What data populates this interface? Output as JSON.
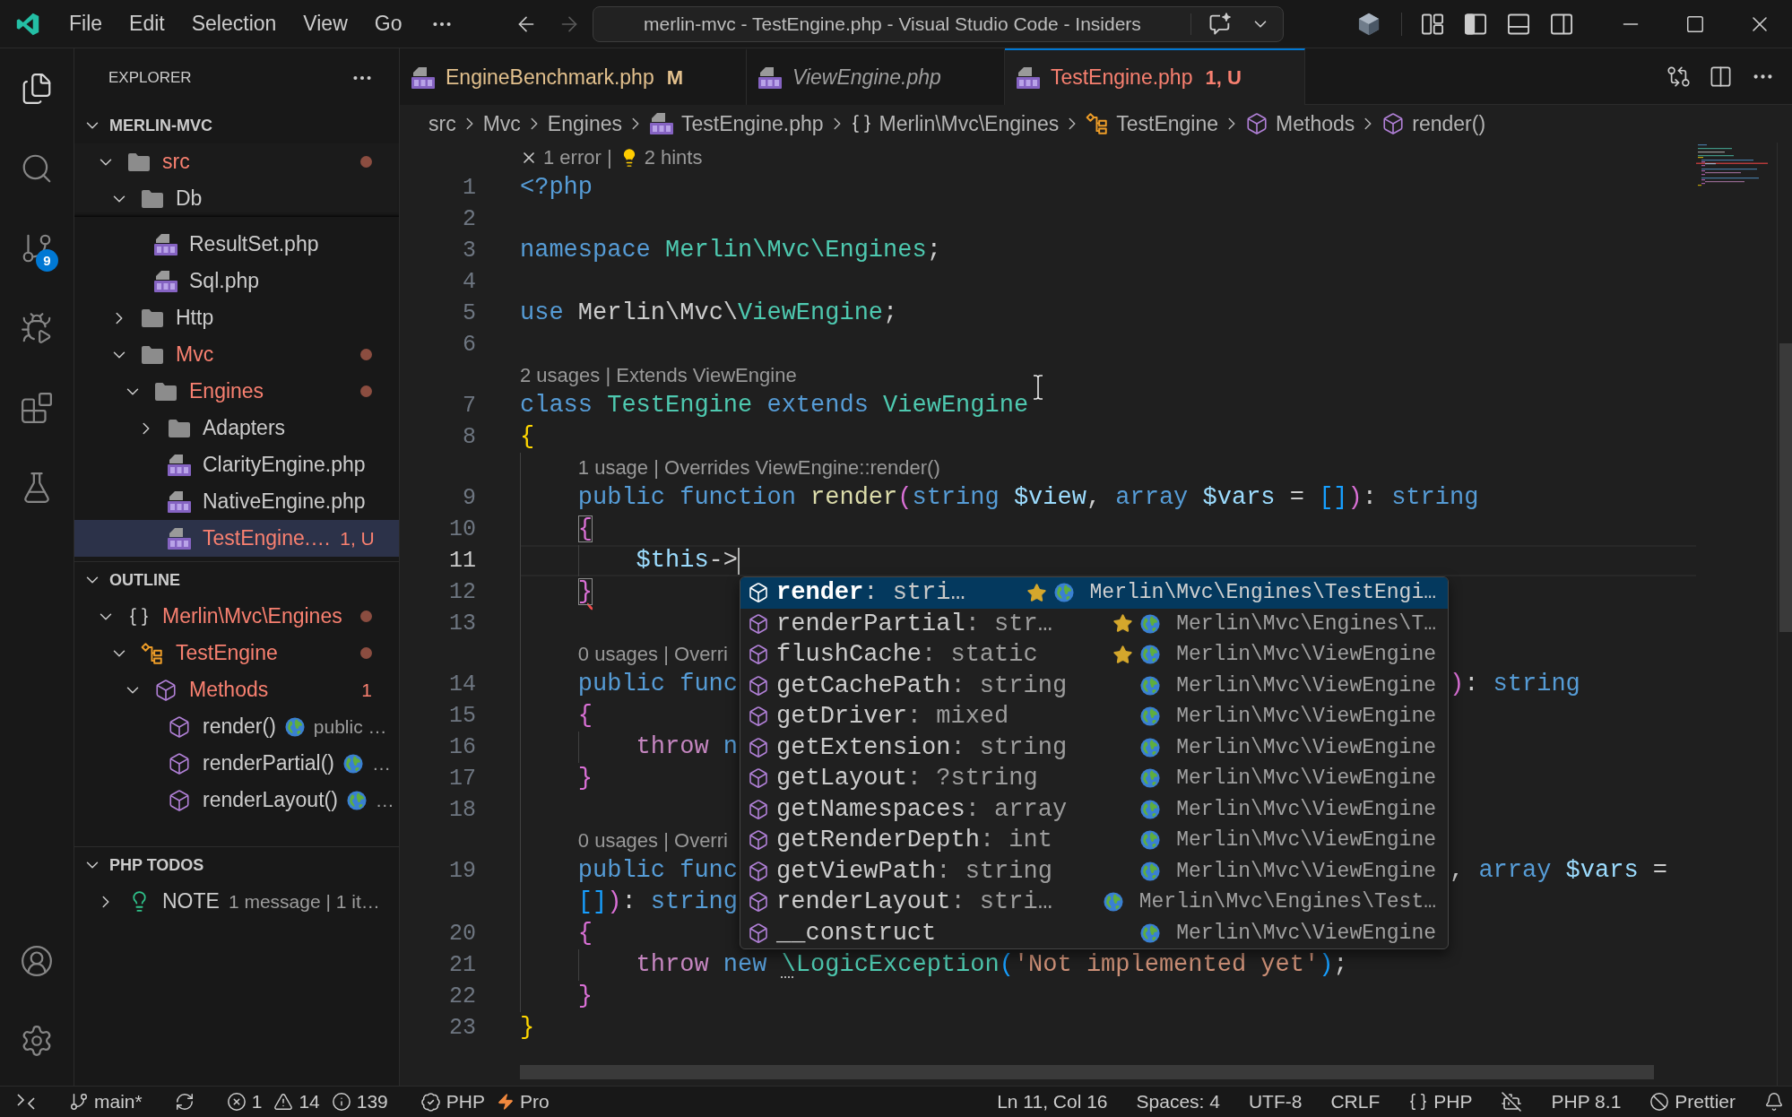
{
  "title_bar": {
    "menu": [
      "File",
      "Edit",
      "Selection",
      "View",
      "Go"
    ],
    "navigation": [
      {
        "kind": "back",
        "disabled": false
      },
      {
        "kind": "forward",
        "disabled": true
      }
    ],
    "command_center": "merlin-mvc - TestEngine.php - Visual Studio Code - Insiders"
  },
  "activity_bar": {
    "items": [
      {
        "kind": "explorer",
        "selected": true
      },
      {
        "kind": "search",
        "selected": false
      },
      {
        "kind": "source-control",
        "selected": false,
        "badge": "9"
      },
      {
        "kind": "run-debug",
        "selected": false
      },
      {
        "kind": "extensions",
        "selected": false
      },
      {
        "kind": "testing",
        "selected": false
      }
    ],
    "bottom": [
      {
        "kind": "accounts"
      },
      {
        "kind": "manage"
      }
    ]
  },
  "sidebar": {
    "title": "EXPLORER",
    "sections": [
      {
        "kind": "files",
        "title": "MERLIN-MVC",
        "expanded": true,
        "items": [
          {
            "kind": "folder",
            "label": "src",
            "expanded": true,
            "error": true,
            "dot": true,
            "sticky": true,
            "selected": false,
            "children": [
              {
                "kind": "folder",
                "label": "Db",
                "expanded": true,
                "error": false,
                "dot": false,
                "sticky": true,
                "selected": false,
                "children": [
                  {
                    "kind": "php",
                    "label": "ResultSet.php",
                    "error": false,
                    "dot": false,
                    "sticky": false,
                    "selected": false
                  },
                  {
                    "kind": "php",
                    "label": "Sql.php",
                    "error": false,
                    "dot": false,
                    "sticky": false,
                    "selected": false
                  }
                ]
              },
              {
                "kind": "folder",
                "label": "Http",
                "expanded": false,
                "error": false,
                "dot": false,
                "sticky": false,
                "selected": false
              },
              {
                "kind": "folder",
                "label": "Mvc",
                "expanded": true,
                "error": true,
                "dot": true,
                "sticky": false,
                "selected": false,
                "children": [
                  {
                    "kind": "folder",
                    "label": "Engines",
                    "expanded": true,
                    "error": true,
                    "dot": true,
                    "sticky": false,
                    "selected": false,
                    "children": [
                      {
                        "kind": "folder",
                        "label": "Adapters",
                        "expanded": false,
                        "error": false,
                        "dot": false,
                        "sticky": false,
                        "selected": false
                      },
                      {
                        "kind": "php",
                        "label": "ClarityEngine.php",
                        "error": false,
                        "dot": false,
                        "sticky": false,
                        "selected": false
                      },
                      {
                        "kind": "php",
                        "label": "NativeEngine.php",
                        "error": false,
                        "dot": false,
                        "sticky": false,
                        "selected": false
                      },
                      {
                        "kind": "php",
                        "label": "TestEngine.…",
                        "badge": "1, U",
                        "error": true,
                        "dot": false,
                        "sticky": false,
                        "selected": true
                      }
                    ]
                  }
                ]
              }
            ]
          }
        ]
      },
      {
        "kind": "outline",
        "title": "OUTLINE",
        "expanded": true,
        "items": [
          {
            "kind": "namespace",
            "label": "Merlin\\Mvc\\Engines",
            "expanded": true,
            "error": true,
            "dot": true,
            "selected": false,
            "children": [
              {
                "kind": "class",
                "label": "TestEngine",
                "expanded": true,
                "error": true,
                "dot": true,
                "selected": false,
                "children": [
                  {
                    "kind": "method",
                    "label": "Methods",
                    "expanded": true,
                    "badge": "1",
                    "error": true,
                    "dot": false,
                    "selected": false,
                    "children": [
                      {
                        "kind": "method",
                        "label": "render()",
                        "description": "public …",
                        "error": false,
                        "dot": false,
                        "selected": false
                      },
                      {
                        "kind": "method",
                        "label": "renderPartial()",
                        "description": "…",
                        "error": false,
                        "dot": false,
                        "selected": false
                      },
                      {
                        "kind": "method",
                        "label": "renderLayout()",
                        "description": "…",
                        "error": false,
                        "dot": false,
                        "selected": false
                      }
                    ]
                  }
                ]
              }
            ]
          }
        ]
      },
      {
        "kind": "todos",
        "title": "PHP TODOS",
        "expanded": true,
        "items": [
          {
            "kind": "note",
            "label": "NOTE",
            "expanded": false,
            "description": "1 message | 1 it…",
            "error": false,
            "dot": false,
            "selected": false
          }
        ]
      }
    ]
  },
  "editor": {
    "tabs": [
      {
        "label": "EngineBenchmark.php",
        "badge": "M",
        "modified": true,
        "error": false,
        "preview": false,
        "selected": false
      },
      {
        "label": "ViewEngine.php",
        "modified": false,
        "error": false,
        "preview": true,
        "selected": false
      },
      {
        "label": "TestEngine.php",
        "badge": "1, U",
        "modified": false,
        "error": true,
        "preview": false,
        "selected": true
      }
    ],
    "breadcrumbs": [
      {
        "kind": "folder",
        "label": "src"
      },
      {
        "kind": "folder",
        "label": "Mvc"
      },
      {
        "kind": "folder",
        "label": "Engines"
      },
      {
        "kind": "php",
        "label": "TestEngine.php"
      },
      {
        "kind": "namespace",
        "label": "Merlin\\Mvc\\Engines"
      },
      {
        "kind": "class",
        "label": "TestEngine"
      },
      {
        "kind": "method",
        "label": "Methods"
      },
      {
        "kind": "method",
        "label": "render()"
      }
    ],
    "rows": [
      {
        "kind": "problems",
        "items": [
          {
            "kind": "error",
            "text": "1 error |"
          },
          {
            "kind": "hint",
            "text": "2 hints"
          }
        ]
      },
      {
        "kind": "code",
        "number": "1",
        "current": false,
        "tokens": [
          {
            "text": "<?php",
            "kind": "keyword"
          }
        ]
      },
      {
        "kind": "code",
        "number": "2",
        "current": false
      },
      {
        "kind": "code",
        "number": "3",
        "current": false,
        "tokens": [
          {
            "text": "namespace ",
            "kind": "keyword"
          },
          {
            "text": "Merlin\\Mvc\\Engines",
            "kind": "type"
          },
          {
            "text": ";",
            "kind": "plain"
          }
        ]
      },
      {
        "kind": "code",
        "number": "4",
        "current": false
      },
      {
        "kind": "code",
        "number": "5",
        "current": false,
        "tokens": [
          {
            "text": "use ",
            "kind": "keyword"
          },
          {
            "text": "Merlin\\Mvc\\",
            "kind": "plain"
          },
          {
            "text": "ViewEngine",
            "kind": "type"
          },
          {
            "text": ";",
            "kind": "plain"
          }
        ]
      },
      {
        "kind": "code",
        "number": "6",
        "current": false
      },
      {
        "kind": "lens",
        "text": "2 usages | Extends ViewEngine"
      },
      {
        "kind": "code",
        "number": "7",
        "current": false,
        "tokens": [
          {
            "text": "class ",
            "kind": "keyword"
          },
          {
            "text": "TestEngine",
            "kind": "type"
          },
          {
            "text": " extends ",
            "kind": "keyword"
          },
          {
            "text": "ViewEngine",
            "kind": "type"
          }
        ]
      },
      {
        "kind": "code",
        "number": "8",
        "current": false,
        "tokens": [
          {
            "text": "{",
            "kind": "bracket1"
          }
        ],
        "children": [
          {
            "kind": "lens",
            "text": "1 usage | Overrides ViewEngine::render()"
          },
          {
            "kind": "code",
            "number": "9",
            "current": false,
            "tokens": [
              {
                "text": "public function ",
                "kind": "keyword"
              },
              {
                "text": "render",
                "kind": "function"
              },
              {
                "text": "(",
                "kind": "bracket2"
              },
              {
                "text": "string ",
                "kind": "keyword"
              },
              {
                "text": "$view",
                "kind": "variable"
              },
              {
                "text": ", ",
                "kind": "plain"
              },
              {
                "text": "array ",
                "kind": "keyword"
              },
              {
                "text": "$vars",
                "kind": "variable"
              },
              {
                "text": " = ",
                "kind": "plain"
              },
              {
                "text": "[]",
                "kind": "bracket3"
              },
              {
                "text": ")",
                "kind": "bracket2"
              },
              {
                "text": ": ",
                "kind": "plain"
              },
              {
                "text": "string",
                "kind": "keyword"
              }
            ]
          },
          {
            "kind": "code",
            "number": "10",
            "current": false,
            "tokens": [
              {
                "text": "{",
                "kind": "bracket2-match"
              }
            ],
            "children": [
              {
                "kind": "code",
                "number": "11",
                "current": true,
                "tokens": [
                  {
                    "text": "$this",
                    "kind": "variable"
                  },
                  {
                    "text": "->",
                    "kind": "plain"
                  }
                ]
              }
            ]
          },
          {
            "kind": "code",
            "number": "12",
            "current": false,
            "tokens": [
              {
                "text": "}",
                "kind": "bracket2-match-error"
              }
            ]
          },
          {
            "kind": "code",
            "number": "13",
            "current": false
          },
          {
            "kind": "lens",
            "text": "0 usages | Overri"
          },
          {
            "kind": "code",
            "number": "14",
            "current": false,
            "tokens": [
              {
                "text": "public func",
                "kind": "keyword"
              }
            ],
            "tail": [
              {
                "text": ")",
                "kind": "bracket2"
              },
              {
                "text": ": ",
                "kind": "plain"
              },
              {
                "text": "string",
                "kind": "keyword"
              }
            ]
          },
          {
            "kind": "code",
            "number": "15",
            "current": false,
            "tokens": [
              {
                "text": "{",
                "kind": "bracket2"
              }
            ],
            "children": [
              {
                "kind": "code",
                "number": "16",
                "current": false,
                "tokens": [
                  {
                    "text": "throw ",
                    "kind": "control"
                  },
                  {
                    "text": "n",
                    "kind": "keyword"
                  }
                ]
              }
            ]
          },
          {
            "kind": "code",
            "number": "17",
            "current": false,
            "tokens": [
              {
                "text": "}",
                "kind": "bracket2"
              }
            ]
          },
          {
            "kind": "code",
            "number": "18",
            "current": false
          },
          {
            "kind": "lens",
            "text": "0 usages | Overri"
          },
          {
            "kind": "code",
            "number": "19",
            "current": false,
            "tokens": [
              {
                "text": "public func",
                "kind": "keyword"
              }
            ],
            "tail": [
              {
                "text": ", ",
                "kind": "plain"
              },
              {
                "text": "array ",
                "kind": "keyword"
              },
              {
                "text": "$vars",
                "kind": "variable"
              },
              {
                "text": " =",
                "kind": "plain"
              }
            ]
          },
          {
            "kind": "wrap",
            "tokens": [
              {
                "text": "[]",
                "kind": "bracket3"
              },
              {
                "text": ")",
                "kind": "bracket2"
              },
              {
                "text": ": ",
                "kind": "plain"
              },
              {
                "text": "string",
                "kind": "keyword"
              }
            ]
          },
          {
            "kind": "code",
            "number": "20",
            "current": false,
            "tokens": [
              {
                "text": "{",
                "kind": "bracket2"
              }
            ],
            "children": [
              {
                "kind": "code",
                "number": "21",
                "current": false,
                "tokens": [
                  {
                    "text": "throw ",
                    "kind": "control"
                  },
                  {
                    "text": "new ",
                    "kind": "keyword"
                  },
                  {
                    "text": "\\",
                    "kind": "type-hint"
                  },
                  {
                    "text": "LogicException",
                    "kind": "type"
                  },
                  {
                    "text": "(",
                    "kind": "bracket3"
                  },
                  {
                    "text": "'Not implemented yet'",
                    "kind": "string"
                  },
                  {
                    "text": ")",
                    "kind": "bracket3"
                  },
                  {
                    "text": ";",
                    "kind": "plain"
                  }
                ]
              }
            ]
          },
          {
            "kind": "code",
            "number": "22",
            "current": false,
            "tokens": [
              {
                "text": "}",
                "kind": "bracket2"
              }
            ]
          }
        ]
      },
      {
        "kind": "code",
        "number": "23",
        "current": false,
        "tokens": [
          {
            "text": "}",
            "kind": "bracket1"
          }
        ]
      }
    ],
    "suggestions": [
      {
        "name": "render",
        "type": ": stri…",
        "detail": "Merlin\\Mvc\\Engines\\TestEngi…",
        "starred": true,
        "selected": true
      },
      {
        "name": "renderPartial",
        "type": ": str…",
        "detail": "Merlin\\Mvc\\Engines\\T…",
        "starred": true,
        "selected": false
      },
      {
        "name": "flushCache",
        "type": ": static",
        "detail": "Merlin\\Mvc\\ViewEngine",
        "starred": true,
        "selected": false
      },
      {
        "name": "getCachePath",
        "type": ": string",
        "detail": "Merlin\\Mvc\\ViewEngine",
        "starred": false,
        "selected": false
      },
      {
        "name": "getDriver",
        "type": ": mixed",
        "detail": "Merlin\\Mvc\\ViewEngine",
        "starred": false,
        "selected": false
      },
      {
        "name": "getExtension",
        "type": ": string",
        "detail": "Merlin\\Mvc\\ViewEngine",
        "starred": false,
        "selected": false
      },
      {
        "name": "getLayout",
        "type": ": ?string",
        "detail": "Merlin\\Mvc\\ViewEngine",
        "starred": false,
        "selected": false
      },
      {
        "name": "getNamespaces",
        "type": ": array",
        "detail": "Merlin\\Mvc\\ViewEngine",
        "starred": false,
        "selected": false
      },
      {
        "name": "getRenderDepth",
        "type": ": int",
        "detail": "Merlin\\Mvc\\ViewEngine",
        "starred": false,
        "selected": false
      },
      {
        "name": "getViewPath",
        "type": ": string",
        "detail": "Merlin\\Mvc\\ViewEngine",
        "starred": false,
        "selected": false
      },
      {
        "name": "renderLayout",
        "type": ": stri…",
        "detail": "Merlin\\Mvc\\Engines\\Test…",
        "starred": false,
        "selected": false
      },
      {
        "name": "__construct",
        "detail": "Merlin\\Mvc\\ViewEngine",
        "starred": false,
        "selected": false
      }
    ]
  },
  "status_bar": {
    "left": [
      {
        "parts": [
          {
            "kind": "remote"
          }
        ]
      },
      {
        "parts": [
          {
            "kind": "branch",
            "text": "main*"
          }
        ]
      },
      {
        "parts": [
          {
            "kind": "sync"
          }
        ]
      },
      {
        "parts": [
          {
            "kind": "error",
            "text": "1"
          },
          {
            "kind": "warning",
            "text": "14"
          },
          {
            "kind": "info",
            "text": "139"
          }
        ]
      },
      {
        "parts": [
          {
            "kind": "verified",
            "text": "PHP"
          },
          {
            "kind": "bolt",
            "text": "Pro"
          }
        ]
      }
    ],
    "right": [
      {
        "parts": [
          {
            "text": "Ln 11, Col 16"
          }
        ]
      },
      {
        "parts": [
          {
            "text": "Spaces: 4"
          }
        ]
      },
      {
        "parts": [
          {
            "text": "UTF-8"
          }
        ]
      },
      {
        "parts": [
          {
            "text": "CRLF"
          }
        ]
      },
      {
        "parts": [
          {
            "kind": "braces",
            "text": "PHP"
          }
        ]
      },
      {
        "parts": [
          {
            "kind": "robot-off"
          }
        ]
      },
      {
        "parts": [
          {
            "text": "PHP 8.1"
          }
        ]
      },
      {
        "parts": [
          {
            "kind": "circle-slash",
            "text": "Prettier"
          }
        ]
      },
      {
        "parts": [
          {
            "kind": "bell"
          }
        ]
      }
    ]
  }
}
